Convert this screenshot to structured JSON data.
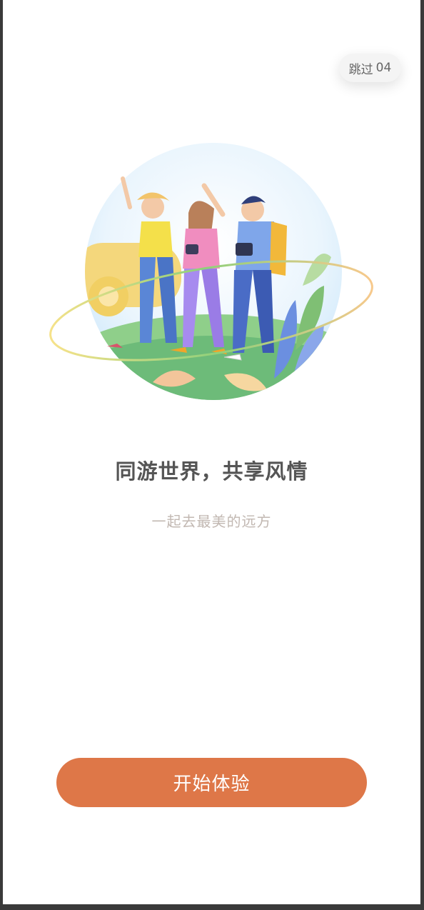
{
  "skip": {
    "label": "跳过",
    "countdown": "04"
  },
  "onboarding": {
    "title": "同游世界，共享风情",
    "subtitle": "一起去最美的远方",
    "illustration_icon": "travel-friends-illustration"
  },
  "start_button": {
    "label": "开始体验"
  },
  "colors": {
    "accent": "#de7748",
    "title": "#555555",
    "subtitle": "#c2b8b2"
  }
}
